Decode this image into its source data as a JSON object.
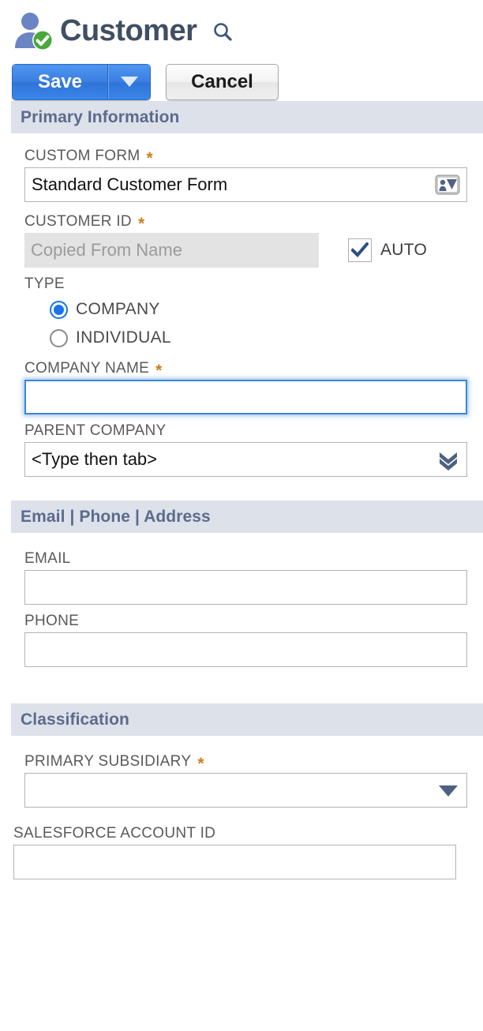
{
  "header": {
    "title": "Customer",
    "record_icon": "customer-person-check-icon",
    "search_icon": "search-icon"
  },
  "toolbar": {
    "save_label": "Save",
    "save_dropdown_icon": "caret-down-icon",
    "cancel_label": "Cancel"
  },
  "sections": [
    {
      "id": "primary_information",
      "title": "Primary Information"
    },
    {
      "id": "email_phone_address",
      "title": "Email | Phone | Address"
    },
    {
      "id": "classification",
      "title": "Classification"
    }
  ],
  "fields": {
    "custom_form": {
      "label": "CUSTOM FORM",
      "required": "*",
      "value": "Standard Customer Form",
      "adorn_icon": "list-select-icon"
    },
    "customer_id": {
      "label": "CUSTOMER ID",
      "required": "*",
      "value": "Copied From Name",
      "readonly": true,
      "auto_label": "AUTO",
      "auto_checked": true,
      "check_icon": "check-icon"
    },
    "type": {
      "label": "TYPE",
      "options": [
        {
          "label": "COMPANY",
          "selected": true
        },
        {
          "label": "INDIVIDUAL",
          "selected": false
        }
      ]
    },
    "company_name": {
      "label": "COMPANY NAME",
      "required": "*",
      "value": "",
      "focused": true
    },
    "parent_company": {
      "label": "PARENT COMPANY",
      "value": "<Type then tab>",
      "adorn_icon": "double-chevron-down-icon"
    },
    "email": {
      "label": "EMAIL",
      "value": ""
    },
    "phone": {
      "label": "PHONE",
      "value": ""
    },
    "primary_subsidiary": {
      "label": "PRIMARY SUBSIDIARY",
      "required": "*",
      "value": "",
      "adorn_icon": "caret-down-icon"
    },
    "salesforce_account_id": {
      "label": "SALESFORCE ACCOUNT ID",
      "value": ""
    }
  },
  "colors": {
    "accent_blue": "#3a7fe0",
    "title_navy": "#3f4f63",
    "section_bar": "#dde1ea",
    "section_text": "#5b6b8c",
    "required_star": "#c8811f",
    "radio_blue": "#1a73e8",
    "check_navy": "#2c4f86"
  }
}
